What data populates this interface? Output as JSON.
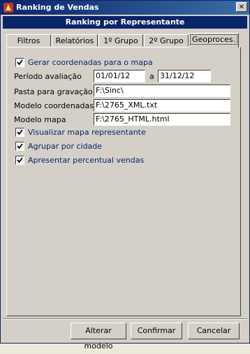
{
  "window": {
    "title": "Ranking de Vendas",
    "close_glyph": "✕"
  },
  "header": {
    "title": "Ranking por Representante"
  },
  "tabs": [
    {
      "label": "Filtros"
    },
    {
      "label": "Relatórios"
    },
    {
      "label": "1º Grupo"
    },
    {
      "label": "2º Grupo"
    },
    {
      "label": "Geoproces."
    }
  ],
  "active_tab": "Geoproces.",
  "form": {
    "gerar_coordenadas": {
      "label": "Gerar coordenadas para o mapa",
      "checked": true
    },
    "periodo": {
      "label": "Período avaliação",
      "start": "01/01/12",
      "separator": "a",
      "end": "31/12/12"
    },
    "pasta": {
      "label": "Pasta para gravação",
      "value": "F:\\Sinc\\"
    },
    "modelo_coordenadas": {
      "label": "Modelo coordenadas",
      "value": "F:\\2765_XML.txt"
    },
    "modelo_mapa": {
      "label": "Modelo mapa",
      "value": "F:\\2765_HTML.html"
    },
    "visualizar_mapa": {
      "label": "Visualizar mapa representante",
      "checked": true
    },
    "agrupar_cidade": {
      "label": "Agrupar por cidade",
      "checked": true
    },
    "percentual_vendas": {
      "label": "Apresentar percentual vendas",
      "checked": true
    }
  },
  "buttons": {
    "alterar_modelo": {
      "label": "Alterar modelo"
    },
    "confirmar": {
      "label": "Confirmar"
    },
    "cancelar": {
      "label": "Cancelar"
    }
  },
  "colors": {
    "title_bar": "#0a246a",
    "checkbox_label": "#0a246a",
    "face": "#d4d0c8"
  }
}
